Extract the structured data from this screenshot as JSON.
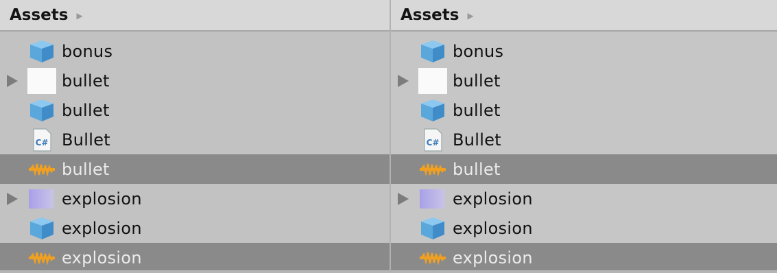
{
  "colors": {
    "header_bg": "#d8d8d8",
    "panel_bg": "#c2c2c2",
    "selected_bg": "#8a8a8a",
    "prefab_blue": "#5aa7dc",
    "audio_orange": "#f0a020"
  },
  "panels": [
    {
      "header": {
        "title": "Assets",
        "arrow_icon": "breadcrumb-arrow-icon"
      },
      "items": [
        {
          "label": "bonus",
          "icon": "prefab-cube-icon",
          "expandable": false,
          "selected": false
        },
        {
          "label": "bullet",
          "icon": "white-texture-icon",
          "expandable": true,
          "selected": false
        },
        {
          "label": "bullet",
          "icon": "prefab-cube-icon",
          "expandable": false,
          "selected": false
        },
        {
          "label": "Bullet",
          "icon": "csharp-script-icon",
          "icon_text": "C#",
          "expandable": false,
          "selected": false
        },
        {
          "label": "bullet",
          "icon": "audio-clip-icon",
          "expandable": false,
          "selected": true
        },
        {
          "label": "explosion",
          "icon": "purple-texture-icon",
          "expandable": true,
          "selected": false
        },
        {
          "label": "explosion",
          "icon": "prefab-cube-icon",
          "expandable": false,
          "selected": false
        },
        {
          "label": "explosion",
          "icon": "audio-clip-icon",
          "expandable": false,
          "selected": true
        }
      ]
    },
    {
      "header": {
        "title": "Assets",
        "arrow_icon": "breadcrumb-arrow-icon"
      },
      "items": [
        {
          "label": "bonus",
          "icon": "prefab-cube-icon",
          "expandable": false,
          "selected": false
        },
        {
          "label": "bullet",
          "icon": "white-texture-icon",
          "expandable": true,
          "selected": false
        },
        {
          "label": "bullet",
          "icon": "prefab-cube-icon",
          "expandable": false,
          "selected": false
        },
        {
          "label": "Bullet",
          "icon": "csharp-script-icon",
          "icon_text": "C#",
          "expandable": false,
          "selected": false
        },
        {
          "label": "bullet",
          "icon": "audio-clip-icon",
          "expandable": false,
          "selected": true
        },
        {
          "label": "explosion",
          "icon": "purple-texture-icon",
          "expandable": true,
          "selected": false
        },
        {
          "label": "explosion",
          "icon": "prefab-cube-icon",
          "expandable": false,
          "selected": false
        },
        {
          "label": "explosion",
          "icon": "audio-clip-icon",
          "expandable": false,
          "selected": true
        }
      ]
    }
  ]
}
